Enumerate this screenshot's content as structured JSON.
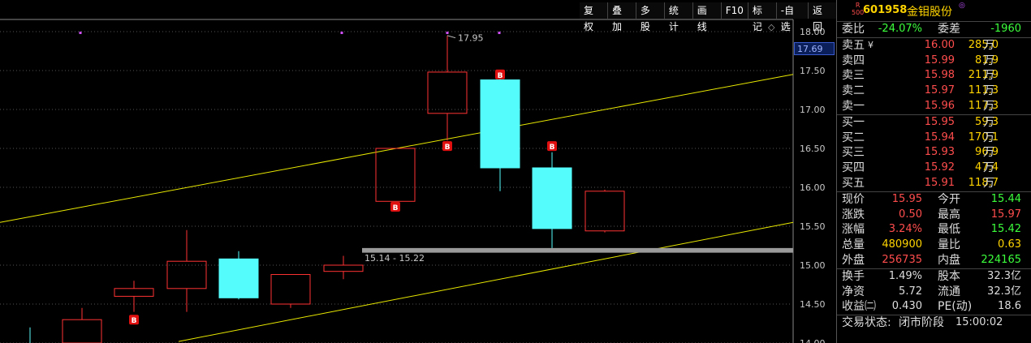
{
  "toolbar": [
    "复权",
    "叠加",
    "多股",
    "统计",
    "画线",
    "F10",
    "标记",
    "-自选",
    "返回"
  ],
  "chart": {
    "price_min": 14.0,
    "price_max": 18.2,
    "y_ticks": [
      "18.00",
      "17.50",
      "17.00",
      "16.50",
      "16.00",
      "15.50",
      "15.00",
      "14.50",
      "14.00"
    ],
    "current_price_label": "17.69",
    "high_annotation": "17.95",
    "range_annotation": "15.14 - 15.22",
    "marker_label": "B",
    "candles": [
      {
        "o": 14.2,
        "c": 14.2,
        "h": 14.2,
        "l": 14.0,
        "type": "line"
      },
      {
        "o": 14.0,
        "c": 14.3,
        "h": 14.45,
        "l": 14.0,
        "type": "up"
      },
      {
        "o": 14.6,
        "c": 14.7,
        "h": 14.8,
        "l": 14.4,
        "type": "up"
      },
      {
        "o": 14.7,
        "c": 15.05,
        "h": 15.45,
        "l": 14.4,
        "type": "up"
      },
      {
        "o": 15.08,
        "c": 14.58,
        "h": 15.18,
        "l": 14.56,
        "type": "down"
      },
      {
        "o": 14.5,
        "c": 14.88,
        "h": 14.88,
        "l": 14.45,
        "type": "up"
      },
      {
        "o": 14.92,
        "c": 15.0,
        "h": 15.12,
        "l": 14.82,
        "type": "up"
      },
      {
        "o": 15.82,
        "c": 16.5,
        "h": 16.5,
        "l": 15.82,
        "type": "up"
      },
      {
        "o": 16.95,
        "c": 17.48,
        "h": 17.95,
        "l": 16.6,
        "type": "up"
      },
      {
        "o": 17.38,
        "c": 16.25,
        "h": 17.4,
        "l": 15.95,
        "type": "down"
      },
      {
        "o": 16.25,
        "c": 15.47,
        "h": 16.45,
        "l": 15.22,
        "type": "down"
      },
      {
        "o": 15.44,
        "c": 15.95,
        "h": 15.97,
        "l": 15.42,
        "type": "up"
      }
    ]
  },
  "quote": {
    "market": "R\n500",
    "code": "601958",
    "name": "金钼股份",
    "badge": "◎",
    "weibi_label": "委比",
    "weibi": "-24.07%",
    "weicha_label": "委差",
    "weicha": "-1960",
    "asks": [
      {
        "label": "卖五",
        "price": "16.00",
        "vol": "285.0"
      },
      {
        "label": "卖四",
        "price": "15.99",
        "vol": "81.9"
      },
      {
        "label": "卖三",
        "price": "15.98",
        "vol": "211.9"
      },
      {
        "label": "卖二",
        "price": "15.97",
        "vol": "111.3"
      },
      {
        "label": "卖一",
        "price": "15.96",
        "vol": "117.3"
      }
    ],
    "bids": [
      {
        "label": "买一",
        "price": "15.95",
        "vol": "59.3"
      },
      {
        "label": "买二",
        "price": "15.94",
        "vol": "170.1"
      },
      {
        "label": "买三",
        "price": "15.93",
        "vol": "96.9"
      },
      {
        "label": "买四",
        "price": "15.92",
        "vol": "47.4"
      },
      {
        "label": "买五",
        "price": "15.91",
        "vol": "118.7"
      }
    ],
    "yen": "¥",
    "unit": "万",
    "stats1": [
      {
        "l1": "现价",
        "v1": "15.95",
        "c1": "red",
        "l2": "今开",
        "v2": "15.44",
        "c2": "green"
      },
      {
        "l1": "涨跌",
        "v1": "0.50",
        "c1": "red",
        "l2": "最高",
        "v2": "15.97",
        "c2": "red"
      },
      {
        "l1": "涨幅",
        "v1": "3.24%",
        "c1": "red",
        "l2": "最低",
        "v2": "15.42",
        "c2": "green"
      },
      {
        "l1": "总量",
        "v1": "480900",
        "c1": "yellow",
        "l2": "量比",
        "v2": "0.63",
        "c2": "yellow"
      },
      {
        "l1": "外盘",
        "v1": "256735",
        "c1": "red",
        "l2": "内盘",
        "v2": "224165",
        "c2": "green"
      }
    ],
    "stats2": [
      {
        "l1": "换手",
        "v1": "1.49%",
        "l2": "股本",
        "v2": "32.3亿"
      },
      {
        "l1": "净资",
        "v1": "5.72",
        "l2": "流通",
        "v2": "32.3亿"
      },
      {
        "l1": "收益㈡",
        "v1": "0.430",
        "l2": "PE(动)",
        "v2": "18.6"
      }
    ],
    "status_label": "交易状态:",
    "status_value": "闭市阶段",
    "status_time": "15:00:02"
  }
}
